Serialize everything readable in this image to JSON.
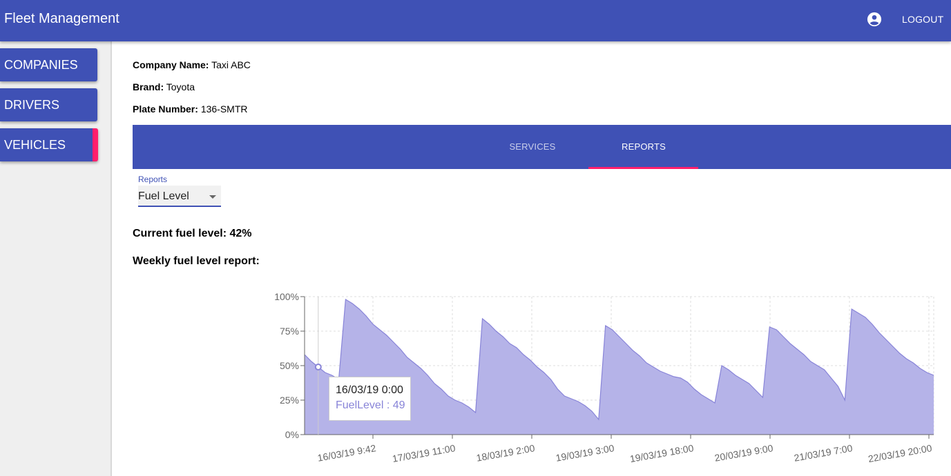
{
  "app": {
    "title": "Fleet Management",
    "logout_label": "LOGOUT",
    "account_icon": "account-circle-icon"
  },
  "sidebar": {
    "items": [
      {
        "label": "COMPANIES",
        "active": false
      },
      {
        "label": "DRIVERS",
        "active": false
      },
      {
        "label": "VEHICLES",
        "active": true
      }
    ]
  },
  "vehicle": {
    "company_label": "Company Name:",
    "company_value": "Taxi ABC",
    "brand_label": "Brand:",
    "brand_value": "Toyota",
    "plate_label": "Plate Number:",
    "plate_value": "136-SMTR"
  },
  "tabs": [
    {
      "label": "SERVICES",
      "active": false
    },
    {
      "label": "REPORTS",
      "active": true
    }
  ],
  "reports_select": {
    "label": "Reports",
    "value": "Fuel Level"
  },
  "current_fuel": "Current fuel level: 42%",
  "weekly_title": "Weekly fuel level report:",
  "tooltip": {
    "date": "16/03/19 0:00",
    "label": "FuelLevel : 49"
  },
  "colors": {
    "primary": "#3f51b5",
    "accent": "#ff1f6c",
    "area_fill": "#b5b3e8",
    "area_stroke": "#8884d8"
  },
  "chart_data": {
    "type": "area",
    "ylim": [
      0,
      100
    ],
    "y_ticks": [
      "0%",
      "25%",
      "50%",
      "75%",
      "100%"
    ],
    "x_tick_labels": [
      "16/03/19 9:42",
      "17/03/19 11:00",
      "18/03/19 2:00",
      "19/03/19 3:00",
      "19/03/19 18:00",
      "20/03/19 9:00",
      "21/03/19 7:00",
      "22/03/19 20:00"
    ],
    "grid": true,
    "series": [
      {
        "name": "FuelLevel",
        "values": [
          58,
          53,
          49,
          45,
          43,
          40,
          98,
          95,
          91,
          86,
          80,
          76,
          72,
          67,
          62,
          56,
          52,
          48,
          43,
          37,
          33,
          28,
          25,
          23,
          20,
          16,
          84,
          80,
          75,
          71,
          66,
          63,
          58,
          54,
          49,
          45,
          40,
          33,
          28,
          26,
          24,
          21,
          17,
          11,
          79,
          76,
          71,
          66,
          61,
          57,
          52,
          49,
          46,
          44,
          42,
          41,
          38,
          33,
          29,
          26,
          23,
          50,
          47,
          43,
          40,
          37,
          32,
          27,
          78,
          76,
          71,
          66,
          62,
          58,
          53,
          50,
          47,
          41,
          35,
          25,
          91,
          88,
          85,
          80,
          74,
          69,
          64,
          59,
          55,
          52,
          48,
          45,
          43
        ]
      }
    ]
  }
}
